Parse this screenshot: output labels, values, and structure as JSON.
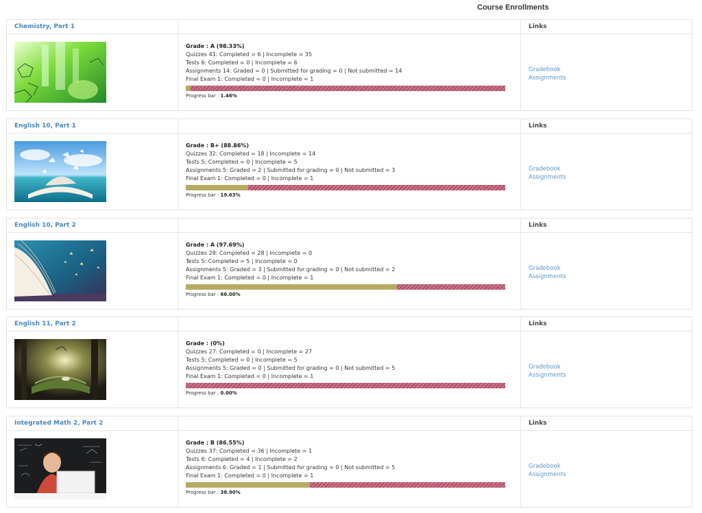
{
  "page_title": "Course Enrollments",
  "links_header": "Links",
  "progress_label": "Progress bar : ",
  "colors": {
    "title_link": "#4a86c0",
    "link": "#5b93c9",
    "progress_fill": "#b5ac62",
    "progress_remaining": "#b34f67"
  },
  "courses": [
    {
      "title": "Chemistry, Part 1",
      "image_icon": "chemistry-lab-image",
      "grade": "Grade : A (98.33%)",
      "quizzes": "Quizzes 41: Completed = 6 | Incomplete = 35",
      "tests": "Tests 6: Completed = 0 | Incomplete = 6",
      "assignments": "Assignments 14: Graded = 0 | Submitted for grading = 0 | Not submitted = 14",
      "final_exam": "Final Exam 1: Completed = 0 | Incomplete = 1",
      "progress_value": "1.46%",
      "progress_percent": 1.46,
      "links": [
        "Gradebook",
        "Assignments"
      ]
    },
    {
      "title": "English 10, Part 1",
      "image_icon": "open-book-sky-image",
      "grade": "Grade : B+ (88.86%)",
      "quizzes": "Quizzes 32: Completed = 18 | Incomplete = 14",
      "tests": "Tests 5: Completed = 0 | Incomplete = 5",
      "assignments": "Assignments 5: Graded = 2 | Submitted for grading = 0 | Not submitted = 3",
      "final_exam": "Final Exam 1: Completed = 0 | Incomplete = 1",
      "progress_value": "19.63%",
      "progress_percent": 19.63,
      "links": [
        "Gradebook",
        "Assignments"
      ]
    },
    {
      "title": "English 10, Part 2",
      "image_icon": "book-pages-butterflies-image",
      "grade": "Grade : A (97.69%)",
      "quizzes": "Quizzes 28: Completed = 28 | Incomplete = 0",
      "tests": "Tests 5: Completed = 5 | Incomplete = 0",
      "assignments": "Assignments 5: Graded = 3 | Submitted for grading = 0 | Not submitted = 2",
      "final_exam": "Final Exam 1: Completed = 0 | Incomplete = 1",
      "progress_value": "66.00%",
      "progress_percent": 66.0,
      "links": [
        "Gradebook",
        "Assignments"
      ]
    },
    {
      "title": "English 11, Part 2",
      "image_icon": "fantasy-forest-book-image",
      "grade": "Grade : (0%)",
      "quizzes": "Quizzes 27: Completed = 0 | Incomplete = 27",
      "tests": "Tests 5: Completed = 0 | Incomplete = 5",
      "assignments": "Assignments 5: Graded = 0 | Submitted for grading = 0 | Not submitted = 5",
      "final_exam": "Final Exam 1: Completed = 0 | Incomplete = 1",
      "progress_value": "0.00%",
      "progress_percent": 0.0,
      "links": [
        "Gradebook",
        "Assignments"
      ]
    },
    {
      "title": "Integrated Math 2, Part 2",
      "image_icon": "student-laptop-chalkboard-image",
      "grade": "Grade : B (86.55%)",
      "quizzes": "Quizzes 37: Completed = 36 | Incomplete = 1",
      "tests": "Tests 6: Completed = 4 | Incomplete = 2",
      "assignments": "Assignments 6: Graded = 1 | Submitted for grading = 0 | Not submitted = 5",
      "final_exam": "Final Exam 1: Completed = 0 | Incomplete = 1",
      "progress_value": "38.90%",
      "progress_percent": 38.9,
      "links": [
        "Gradebook",
        "Assignments"
      ]
    }
  ]
}
